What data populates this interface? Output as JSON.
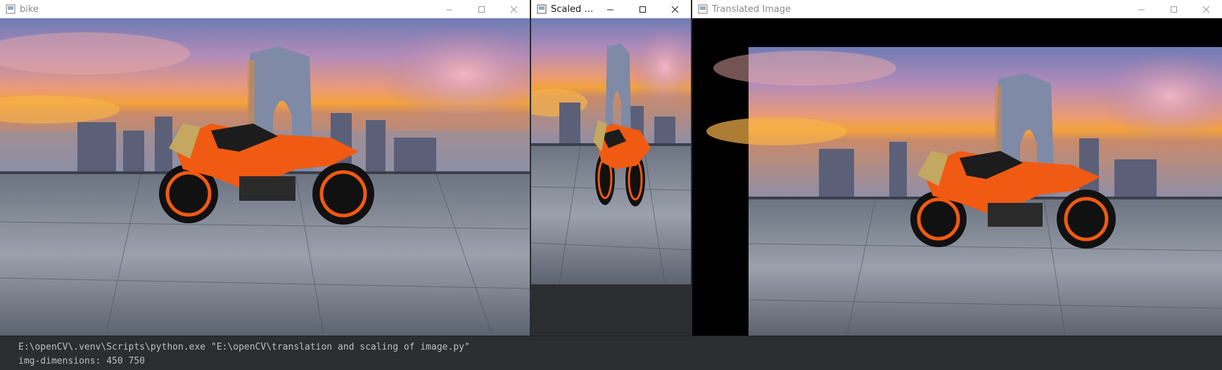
{
  "windows": [
    {
      "id": "bike",
      "title": "bike",
      "active": false
    },
    {
      "id": "scaled",
      "title": "Scaled I...",
      "active": true
    },
    {
      "id": "translated",
      "title": "Translated Image",
      "active": false
    }
  ],
  "controls": {
    "minimize": "minimize-icon",
    "maximize": "maximize-icon",
    "close": "close-icon"
  },
  "terminal": {
    "line1": "E:\\openCV\\.venv\\Scripts\\python.exe \"E:\\openCV\\translation and scaling of image.py\"",
    "line2": "img-dimensions: 450 750"
  },
  "colors": {
    "sky_top": "#6f7bb5",
    "sky_sunset": "#f4a23c",
    "ground": "#8a93a0",
    "bike_orange": "#f15a12",
    "translation_border": "#000000"
  }
}
